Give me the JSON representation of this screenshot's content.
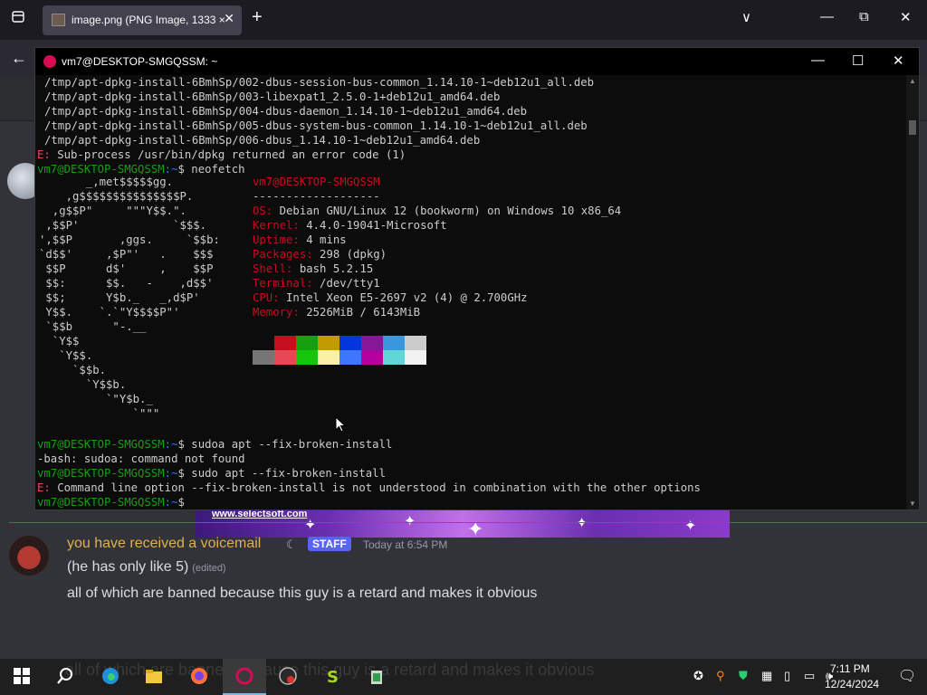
{
  "browser": {
    "tab_title": "image.png (PNG Image, 1333 ×",
    "tab_close": "✕",
    "new_tab": "+",
    "back": "←",
    "list_tabs": "▣",
    "controls": {
      "dropdown": "∨",
      "minimize": "—",
      "maximize": "⧉",
      "close": "✕"
    }
  },
  "terminal": {
    "title": "vm7@DESKTOP-SMGQSSM: ~",
    "controls": {
      "minimize": "—",
      "maximize": "☐",
      "close": "✕"
    },
    "lines_top": [
      "/tmp/apt-dpkg-install-6BmhSp/002-dbus-session-bus-common_1.14.10-1~deb12u1_all.deb",
      "/tmp/apt-dpkg-install-6BmhSp/003-libexpat1_2.5.0-1+deb12u1_amd64.deb",
      "/tmp/apt-dpkg-install-6BmhSp/004-dbus-daemon_1.14.10-1~deb12u1_amd64.deb",
      "/tmp/apt-dpkg-install-6BmhSp/005-dbus-system-bus-common_1.14.10-1~deb12u1_all.deb",
      "/tmp/apt-dpkg-install-6BmhSp/006-dbus_1.14.10-1~deb12u1_amd64.deb"
    ],
    "error1_prefix": "E:",
    "error1_text": " Sub-process /usr/bin/dpkg returned an error code (1)",
    "prompt_user": "vm7@DESKTOP-SMGQSSM",
    "prompt_path": ":~",
    "prompt_sigil": "$ ",
    "cmd_neofetch": "neofetch",
    "logo": [
      "       _,met$$$$$gg.",
      "    ,g$$$$$$$$$$$$$$$P.",
      "  ,g$$P\"     \"\"\"Y$$.\".",
      " ,$$P'              `$$$.",
      "',$$P       ,ggs.     `$$b:",
      "`d$$'     ,$P\"'   .    $$$",
      " $$P      d$'     ,    $$P",
      " $$:      $$.   -    ,d$$'",
      " $$;      Y$b._   _,d$P'",
      " Y$$.    `.`\"Y$$$$P\"'",
      " `$$b      \"-.__",
      "  `Y$$",
      "   `Y$$.",
      "     `$$b.",
      "       `Y$$b.",
      "          `\"Y$b._",
      "              `\"\"\""
    ],
    "nf_title": "vm7@DESKTOP-SMGQSSM",
    "nf_rule": "-------------------",
    "nf_rows": [
      {
        "label": "OS",
        "value": " Debian GNU/Linux 12 (bookworm) on Windows 10 x86_64"
      },
      {
        "label": "Kernel",
        "value": " 4.4.0-19041-Microsoft"
      },
      {
        "label": "Uptime",
        "value": " 4 mins"
      },
      {
        "label": "Packages",
        "value": " 298 (dpkg)"
      },
      {
        "label": "Shell",
        "value": " bash 5.2.15"
      },
      {
        "label": "Terminal",
        "value": " /dev/tty1"
      },
      {
        "label": "CPU",
        "value": " Intel Xeon E5-2697 v2 (4) @ 2.700GHz"
      },
      {
        "label": "Memory",
        "value": " 2526MiB / 6143MiB"
      }
    ],
    "palette_top": [
      "#0c0c0c",
      "#c50f1f",
      "#13a10e",
      "#c19c00",
      "#0037da",
      "#881798",
      "#3a96dd",
      "#cccccc"
    ],
    "palette_bottom": [
      "#767676",
      "#e74856",
      "#16c60c",
      "#f9f1a5",
      "#3b78ff",
      "#b4009e",
      "#61d6d6",
      "#f2f2f2"
    ],
    "cmd_sudoa": "sudoa apt --fix-broken-install",
    "bash_error": "-bash: sudoa: command not found",
    "cmd_sudo": "sudo apt --fix-broken-install",
    "error2_prefix": "E:",
    "error2_text": " Command line option --fix-broken-install is not understood in combination with the other options"
  },
  "discord": {
    "ad_url": "www.selectsoft.com",
    "author": "you have received a voicemail",
    "badge": "STAFF",
    "timestamp": "Today at 6:54 PM",
    "line1": "(he has only like 5)",
    "edited": "(edited)",
    "line2": "all of which are banned because this guy is a retard and makes it obvious"
  },
  "taskbar": {
    "ghost_text": "all of which are banned because this guy is a retard and makes it obvious",
    "time": "7:11 PM",
    "date": "12/24/2024"
  },
  "colors": {
    "terminal_green": "#13a10e",
    "terminal_red": "#e74856",
    "terminal_blue": "#3b78ff",
    "discord_author": "#e0b04a",
    "staff_badge": "#5865f2"
  }
}
